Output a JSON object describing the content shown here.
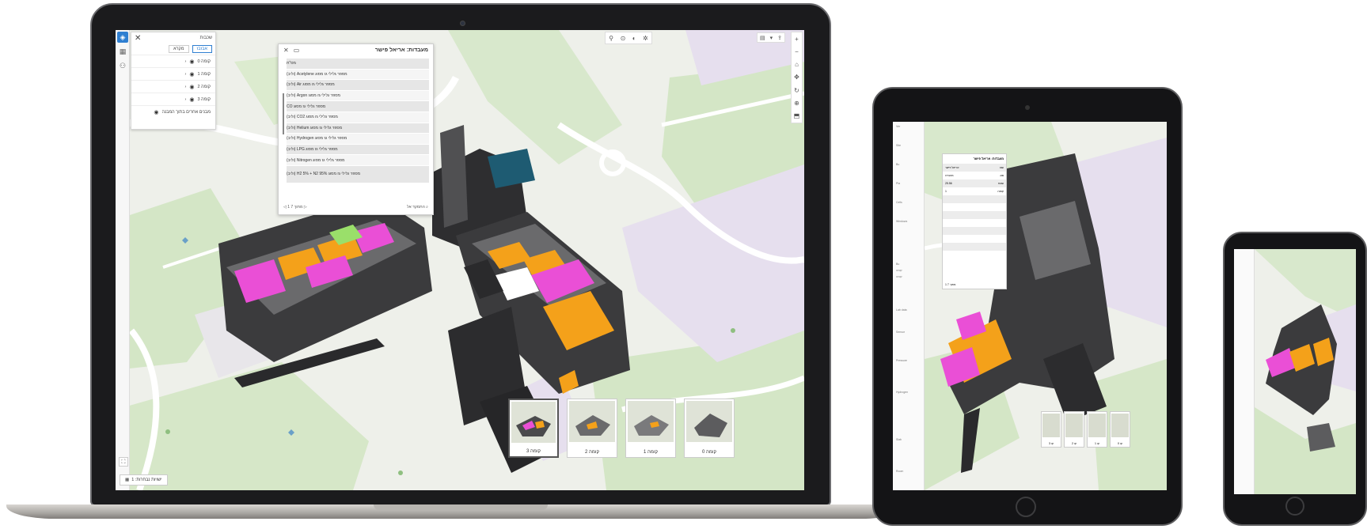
{
  "laptop_app": {
    "layers_panel": {
      "title": "שכבות",
      "tabs": [
        "אבזבז",
        "מקרא"
      ],
      "floors": [
        "קומה 0",
        "קומה 1",
        "קומה 2",
        "קומה 3"
      ],
      "footer": "מבנים אחרים בתוך המבנה"
    },
    "popup": {
      "title": "מעבדות: אריאל פישר",
      "rows": [
        "מס\"ת",
        "מספר גלילי גז מסוג Acetylene (וליב)",
        "מספר גלילי גז מסוג Air (וליב)",
        "מספר גלילי גז מסוג Argon (וליב)",
        "מספר גלילי גז מסוג CO",
        "מספר גלילי גז מסוג CO2 (וליב)",
        "מספר גלילי גז מסוג Helium (וליב)",
        "מספר גלילי גז מסוג Hydrogen (וליב)",
        "מספר גלילי גז מסוג LPG (וליב)",
        "מספר גלילי גז מסוג Nitrogen (וליב)",
        "מספר גלילי גז מסוג H2 5% + N2 95% (וליב)"
      ],
      "pager": "1 מתוך 7",
      "zoom_label": "התמקד אל"
    },
    "thumbnails": [
      "קומה 3",
      "קומה 2",
      "קומה 1",
      "קומה 0"
    ],
    "bottom_button": "ישויות נבחרות: 1"
  },
  "tablet_app": {
    "left_items": [
      "Ver",
      "Site",
      "Bu",
      "Pla",
      "Cells",
      "Windows",
      "Bu",
      "קומה",
      "קומה",
      "Lab data",
      "Sensor",
      "Pressure",
      "Hydrogen",
      "Slab",
      "Room"
    ],
    "popup_title": "מעבדות: אריאל פישר",
    "popup_rows": [
      [
        "שם",
        "אריאל פישר"
      ],
      [
        "סוג",
        "מעבדה"
      ],
      [
        "שטח",
        "25.56"
      ],
      [
        "קומה",
        "1"
      ],
      [
        "",
        ""
      ],
      [
        "",
        ""
      ],
      [
        "",
        ""
      ],
      [
        "",
        ""
      ],
      [
        "",
        ""
      ],
      [
        "",
        ""
      ],
      [
        "",
        ""
      ],
      [
        "",
        ""
      ]
    ],
    "popup_pager": "1 מתוך 7",
    "thumbs": [
      "3 קו",
      "2 קו",
      "1 קו",
      "0 קו"
    ]
  },
  "colors": {
    "map_green": "#cfe2c1",
    "map_light": "#eef0ea",
    "map_road": "#ffffff",
    "map_violet": "#e8e1ef",
    "building_dark": "#3b3b3d",
    "lab_orange": "#f4a11a",
    "lab_magenta": "#ea4fd6",
    "accent_blue": "#2f7fd1"
  }
}
